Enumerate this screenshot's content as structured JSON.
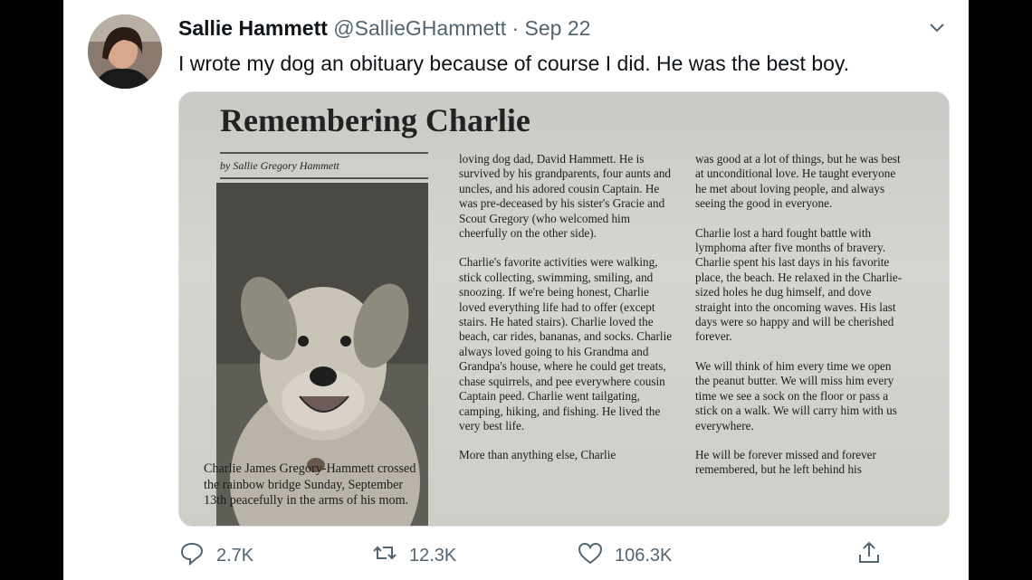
{
  "tweet": {
    "display_name": "Sallie Hammett",
    "handle": "@SallieGHammett",
    "separator": "·",
    "date": "Sep 22",
    "text": "I wrote my dog an obituary because of course I did. He was the best boy."
  },
  "article": {
    "title": "Remembering Charlie",
    "byline": "by Sallie Gregory Hammett",
    "caption": "Charlie James Gregory-Hammett crossed the rainbow bridge Sunday, September 13th peacefully in the arms of his mom.",
    "col2": [
      "loving dog dad, David Hammett. He is survived by his grandparents, four aunts and uncles, and his adored cousin Captain. He was pre-deceased by his sister's Gracie and Scout Gregory (who welcomed him cheerfully on the other side).",
      "Charlie's favorite activities were walking, stick collecting, swimming, smiling, and snoozing. If we're being honest, Charlie loved everything life had to offer (except stairs. He hated stairs). Charlie loved the beach, car rides, bananas, and socks. Charlie always loved going to his Grandma and Grandpa's house, where he could get treats, chase squirrels, and pee everywhere cousin Captain peed. Charlie went tailgating, camping, hiking, and fishing. He lived the very best life.",
      "More than anything else, Charlie"
    ],
    "col3": [
      "was good at a lot of things, but he was best at unconditional love. He taught everyone he met about loving people, and always seeing the good in everyone.",
      "Charlie lost a hard fought battle with lymphoma after five months of bravery. Charlie spent his last days in his favorite place, the beach. He relaxed in the Charlie-sized holes he dug himself, and dove straight into the oncoming waves. His last days were so happy and will be cherished forever.",
      "We will think of him every time we open the peanut butter. We will miss him every time we see a sock on the floor or pass a stick on a walk. We will carry him with us everywhere.",
      "He will be forever missed and forever remembered, but he left behind his"
    ]
  },
  "actions": {
    "reply_count": "2.7K",
    "retweet_count": "12.3K",
    "like_count": "106.3K"
  },
  "icons": {
    "menu": "chevron-down-icon",
    "reply": "reply-icon",
    "retweet": "retweet-icon",
    "like": "heart-icon",
    "share": "share-icon"
  },
  "colors": {
    "text": "#0f1419",
    "secondary": "#536471",
    "background": "#ffffff",
    "outer": "#000000"
  }
}
